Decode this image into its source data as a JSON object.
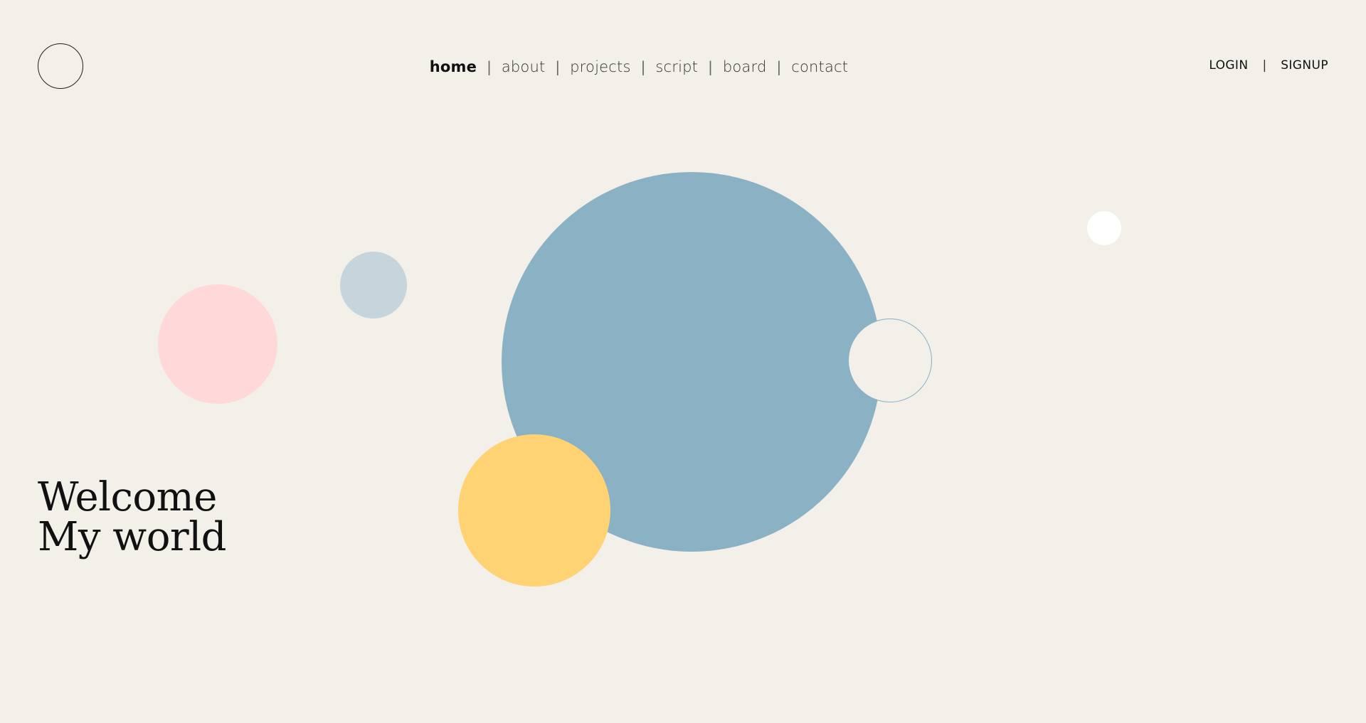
{
  "nav": {
    "items": [
      {
        "label": "home",
        "active": true
      },
      {
        "label": "about",
        "active": false
      },
      {
        "label": "projects",
        "active": false
      },
      {
        "label": "script",
        "active": false
      },
      {
        "label": "board",
        "active": false
      },
      {
        "label": "contact",
        "active": false
      }
    ],
    "separator": "|"
  },
  "auth": {
    "login": "LOGIN",
    "separator": "|",
    "signup": "SIGNUP"
  },
  "hero": {
    "line1": "Welcome",
    "line2": "My world"
  },
  "colors": {
    "background": "#f3efe9",
    "pink": "#ffd8d9",
    "grey_blue": "#c6d4dc",
    "blue": "#8ab1c4",
    "yellow": "#ffd273",
    "white": "#ffffff"
  }
}
